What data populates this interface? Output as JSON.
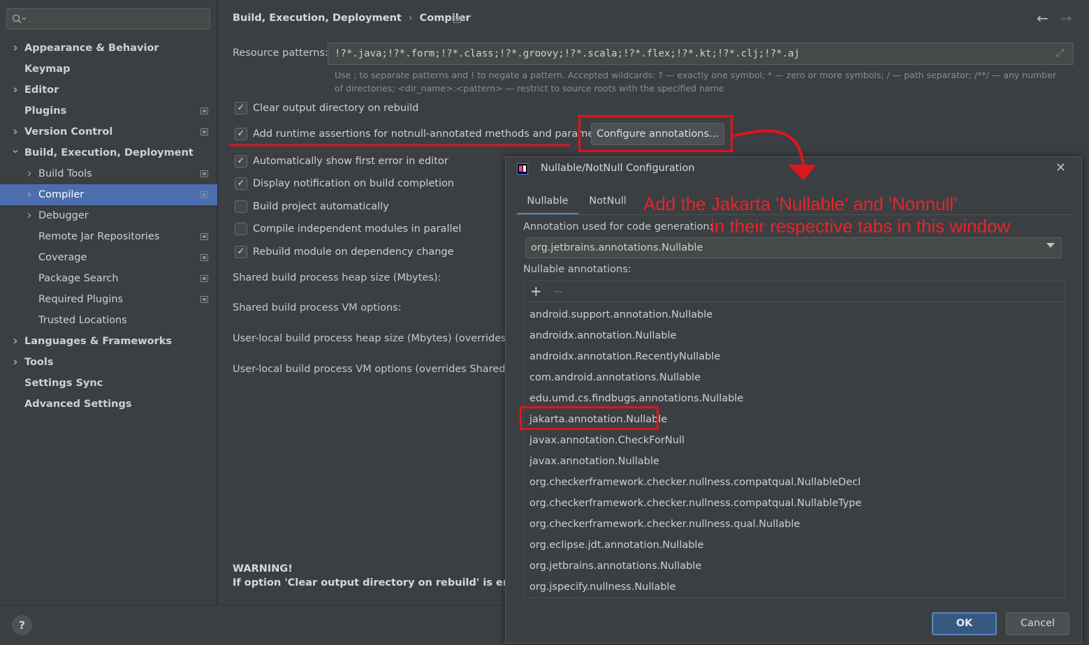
{
  "sidebar": {
    "items": [
      {
        "label": "Appearance & Behavior"
      },
      {
        "label": "Keymap"
      },
      {
        "label": "Editor"
      },
      {
        "label": "Plugins"
      },
      {
        "label": "Version Control"
      },
      {
        "label": "Build, Execution, Deployment"
      },
      {
        "label": "Build Tools"
      },
      {
        "label": "Compiler"
      },
      {
        "label": "Debugger"
      },
      {
        "label": "Remote Jar Repositories"
      },
      {
        "label": "Coverage"
      },
      {
        "label": "Package Search"
      },
      {
        "label": "Required Plugins"
      },
      {
        "label": "Trusted Locations"
      },
      {
        "label": "Languages & Frameworks"
      },
      {
        "label": "Tools"
      },
      {
        "label": "Settings Sync"
      },
      {
        "label": "Advanced Settings"
      }
    ],
    "selected": "Compiler"
  },
  "help_label": "?",
  "header": {
    "breadcrumb": [
      "Build, Execution, Deployment",
      "Compiler"
    ],
    "separator": "›",
    "back": "←",
    "forward": "→"
  },
  "main": {
    "resource_label": "Resource patterns:",
    "resource_value": "!?*.java;!?*.form;!?*.class;!?*.groovy;!?*.scala;!?*.flex;!?*.kt;!?*.clj;!?*.aj",
    "resource_hint": "Use ; to separate patterns and ! to negate a pattern. Accepted wildcards: ? — exactly one symbol; * — zero or more symbols; / — path separator; /**/ — any number of directories; <dir_name>:<pattern> — restrict to source roots with the specified name",
    "checkboxes": [
      {
        "label": "Clear output directory on rebuild",
        "checked": true
      },
      {
        "label": "Add runtime assertions for notnull-annotated methods and parameters",
        "checked": true
      },
      {
        "label": "Automatically show first error in editor",
        "checked": true
      },
      {
        "label": "Display notification on build completion",
        "checked": true
      },
      {
        "label": "Build project automatically",
        "checked": false
      },
      {
        "label": "Compile independent modules in parallel",
        "checked": false
      },
      {
        "label": "Rebuild module on dependency change",
        "checked": true
      }
    ],
    "configure_button": "Configure annotations...",
    "heap_label": "Shared build process heap size (Mbytes):",
    "vm_label": "Shared build process VM options:",
    "user_heap_label": "User-local build process heap size (Mbytes) (overrides Shar",
    "user_vm_label": "User-local build process VM options (overrides Shared opti",
    "warning_title": "WARNING!",
    "warning_text": "If option 'Clear output directory on rebuild' is enabled, t"
  },
  "dialog": {
    "title": "Nullable/NotNull Configuration",
    "close": "✕",
    "tabs": [
      "Nullable",
      "NotNull"
    ],
    "active_tab": "Nullable",
    "annotation_label": "Annotation used for code generation:",
    "annotation_value": "org.jetbrains.annotations.Nullable",
    "list_label": "Nullable annotations:",
    "add": "+",
    "remove": "−",
    "items": [
      "android.support.annotation.Nullable",
      "androidx.annotation.Nullable",
      "androidx.annotation.RecentlyNullable",
      "com.android.annotations.Nullable",
      "edu.umd.cs.findbugs.annotations.Nullable",
      "jakarta.annotation.Nullable",
      "javax.annotation.CheckForNull",
      "javax.annotation.Nullable",
      "org.checkerframework.checker.nullness.compatqual.NullableDecl",
      "org.checkerframework.checker.nullness.compatqual.NullableType",
      "org.checkerframework.checker.nullness.qual.Nullable",
      "org.eclipse.jdt.annotation.Nullable",
      "org.jetbrains.annotations.Nullable",
      "org.jspecify.nullness.Nullable"
    ],
    "highlighted_item": "jakarta.annotation.Nullable",
    "ok": "OK",
    "cancel": "Cancel"
  },
  "annotation": {
    "line1": "Add the Jakarta 'Nullable' and 'Nonnull'",
    "line2": "in their respective tabs in this window",
    "color": "#e8232b"
  }
}
